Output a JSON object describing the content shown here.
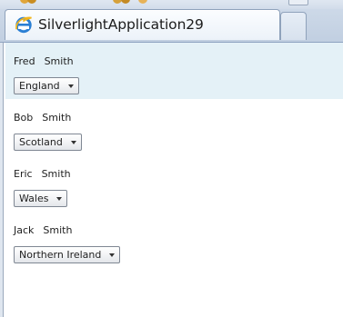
{
  "browser": {
    "tab_title": "SilverlightApplication29",
    "icon": "internet-explorer-icon"
  },
  "people": [
    {
      "first_name": "Fred",
      "last_name": "Smith",
      "country": "England",
      "selected": true
    },
    {
      "first_name": "Bob",
      "last_name": "Smith",
      "country": "Scotland",
      "selected": false
    },
    {
      "first_name": "Eric",
      "last_name": "Smith",
      "country": "Wales",
      "selected": false
    },
    {
      "first_name": "Jack",
      "last_name": "Smith",
      "country": "Northern Ireland",
      "selected": false
    }
  ],
  "colors": {
    "selected_row_background": "#e4f1f7",
    "tab_background": "#ecf2f9"
  }
}
